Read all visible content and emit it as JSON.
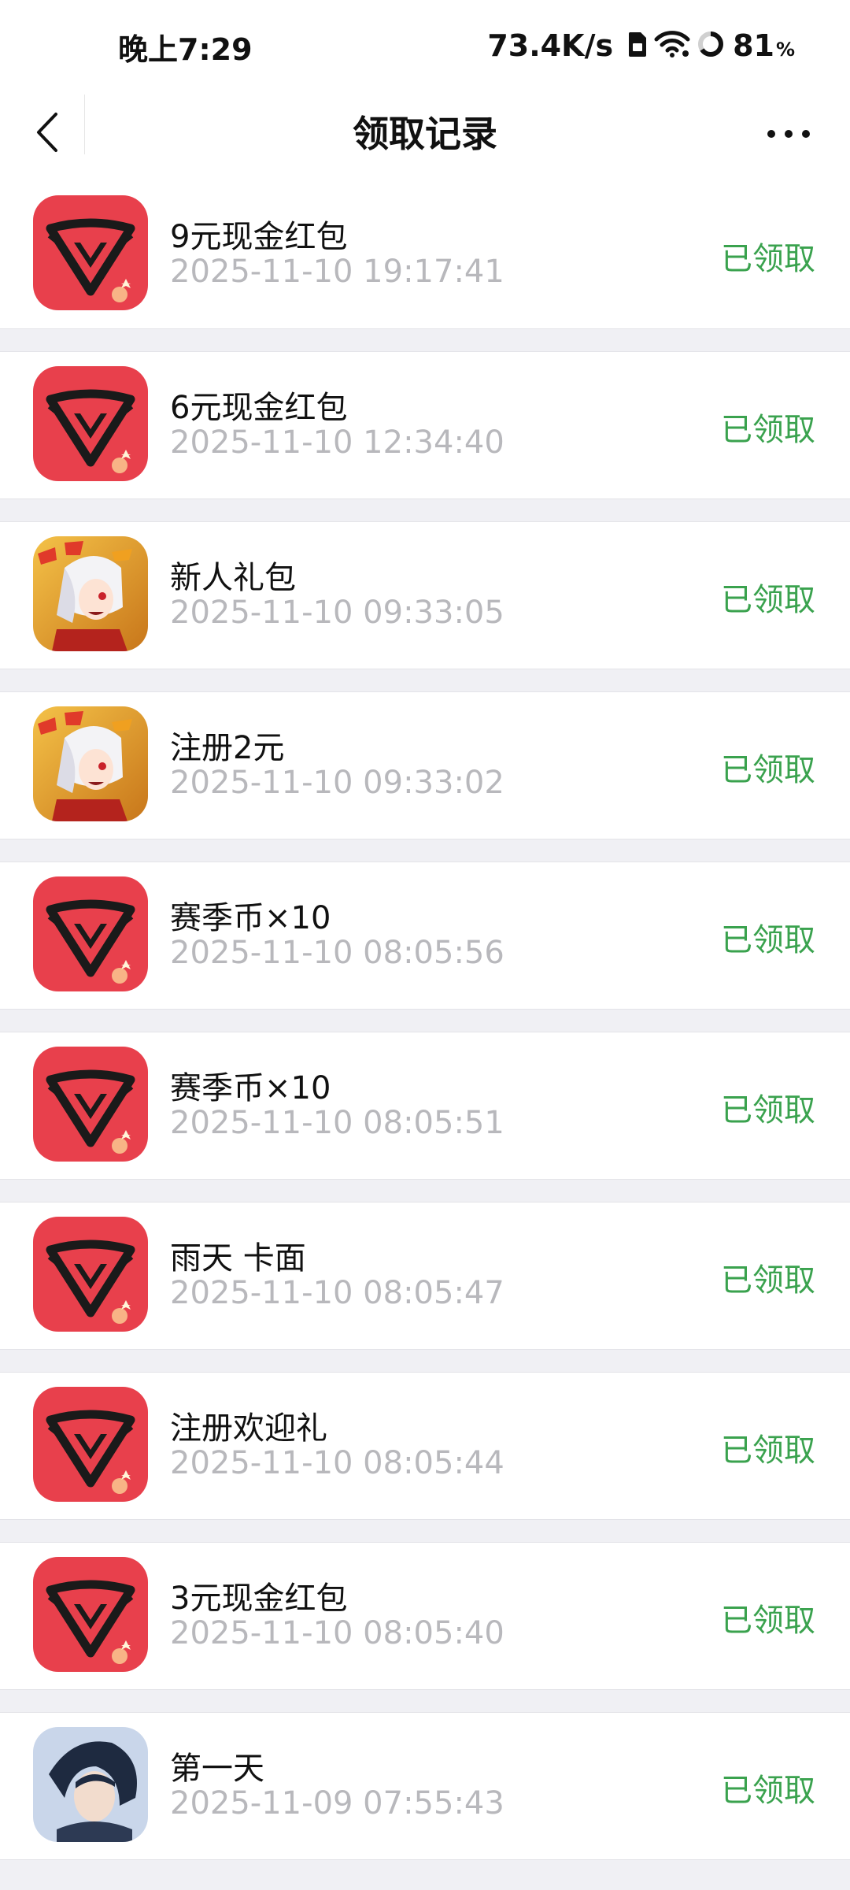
{
  "status_bar": {
    "time": "晚上7:29",
    "net_speed": "73.4K/s",
    "battery_level": "81",
    "battery_unit": "%",
    "icons": [
      "sim-card-icon",
      "wifi-icon",
      "battery-ring-icon"
    ]
  },
  "nav": {
    "title": "领取记录",
    "back_icon": "chevron-left-icon",
    "more_icon": "more-dots-icon"
  },
  "theme": {
    "claimed_color": "#3aa24e",
    "time_color": "#b8b8bc",
    "divider_bg": "#f0f0f4"
  },
  "records": [
    {
      "icon": "red-shield-game-icon",
      "title": "9元现金红包",
      "time": "2025-11-10 19:17:41",
      "status": "已领取"
    },
    {
      "icon": "red-shield-game-icon",
      "title": "6元现金红包",
      "time": "2025-11-10 12:34:40",
      "status": "已领取"
    },
    {
      "icon": "anime-character-game-icon",
      "title": "新人礼包",
      "time": "2025-11-10 09:33:05",
      "status": "已领取"
    },
    {
      "icon": "anime-character-game-icon",
      "title": "注册2元",
      "time": "2025-11-10 09:33:02",
      "status": "已领取"
    },
    {
      "icon": "red-shield-game-icon",
      "title": "赛季币×10",
      "time": "2025-11-10 08:05:56",
      "status": "已领取"
    },
    {
      "icon": "red-shield-game-icon",
      "title": "赛季币×10",
      "time": "2025-11-10 08:05:51",
      "status": "已领取"
    },
    {
      "icon": "red-shield-game-icon",
      "title": "雨天 卡面",
      "time": "2025-11-10 08:05:47",
      "status": "已领取"
    },
    {
      "icon": "red-shield-game-icon",
      "title": "注册欢迎礼",
      "time": "2025-11-10 08:05:44",
      "status": "已领取"
    },
    {
      "icon": "red-shield-game-icon",
      "title": "3元现金红包",
      "time": "2025-11-10 08:05:40",
      "status": "已领取"
    },
    {
      "icon": "portrait-game-icon",
      "title": "第一天",
      "time": "2025-11-09 07:55:43",
      "status": "已领取"
    }
  ]
}
